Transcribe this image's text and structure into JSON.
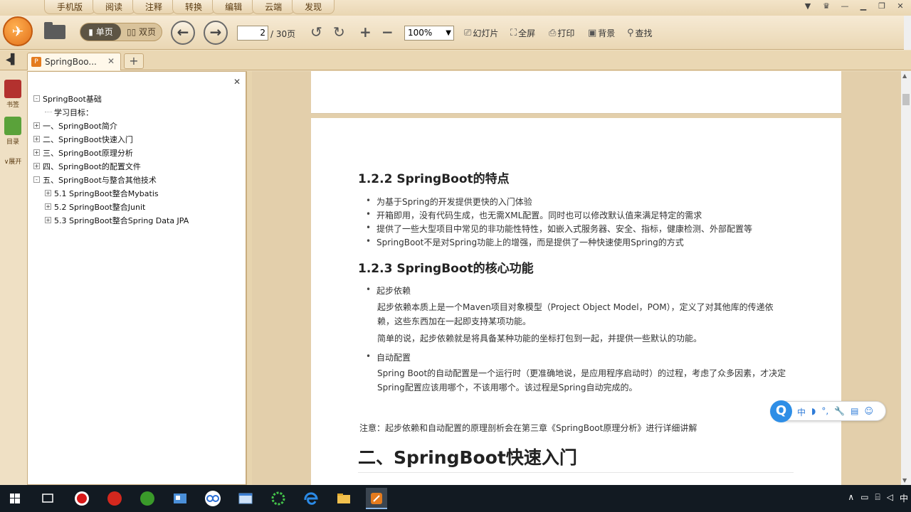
{
  "menu": {
    "tabs": [
      "手机版",
      "阅读",
      "注释",
      "转换",
      "编辑",
      "云端",
      "发现"
    ]
  },
  "toolbar": {
    "single_page": "单页",
    "double_page": "双页",
    "current_page": "2",
    "total_pages": "/ 30页",
    "zoom": "100%",
    "slideshow": "幻灯片",
    "fullscreen": "全屏",
    "print": "打印",
    "background": "背景",
    "find": "查找"
  },
  "tabs": {
    "doc_title": "SpringBoo..."
  },
  "sidebar": {
    "bookmarks": "书签",
    "toc": "目录",
    "expand": "展开"
  },
  "outline": {
    "items": [
      {
        "label": "SpringBoot基础",
        "level": 0,
        "expander": "-"
      },
      {
        "label": "学习目标：",
        "level": 1,
        "expander": ""
      },
      {
        "label": "一、SpringBoot简介",
        "level": 0,
        "expander": "+"
      },
      {
        "label": "二、SpringBoot快速入门",
        "level": 0,
        "expander": "+"
      },
      {
        "label": "三、SpringBoot原理分析",
        "level": 0,
        "expander": "+"
      },
      {
        "label": "四、SpringBoot的配置文件",
        "level": 0,
        "expander": "+"
      },
      {
        "label": "五、SpringBoot与整合其他技术",
        "level": 0,
        "expander": "-"
      },
      {
        "label": "5.1 SpringBoot整合Mybatis",
        "level": 1,
        "expander": "+"
      },
      {
        "label": "5.2 SpringBoot整合Junit",
        "level": 1,
        "expander": "+"
      },
      {
        "label": "5.3 SpringBoot整合Spring Data JPA",
        "level": 1,
        "expander": "+"
      }
    ]
  },
  "document": {
    "h_features": "1.2.2 SpringBoot的特点",
    "features": [
      "为基于Spring的开发提供更快的入门体验",
      "开箱即用，没有代码生成，也无需XML配置。同时也可以修改默认值来满足特定的需求",
      "提供了一些大型项目中常见的非功能性特性，如嵌入式服务器、安全、指标，健康检测、外部配置等",
      "SpringBoot不是对Spring功能上的增强，而是提供了一种快速使用Spring的方式"
    ],
    "h_core": "1.2.3 SpringBoot的核心功能",
    "dep_title": "起步依赖",
    "dep_para1_line1": "起步依赖本质上是一个Maven项目对象模型（Project Object Model，POM），定义了对其他库的传递依",
    "dep_para1_line2": "赖，这些东西加在一起即支持某项功能。",
    "dep_para2": "简单的说，起步依赖就是将具备某种功能的坐标打包到一起，并提供一些默认的功能。",
    "auto_title": "自动配置",
    "auto_para_line1": "Spring Boot的自动配置是一个运行时（更准确地说，是应用程序启动时）的过程，考虑了众多因素，才决定",
    "auto_para_line2": "Spring配置应该用哪个，不该用哪个。该过程是Spring自动完成的。",
    "note": "注意：起步依赖和自动配置的原理剖析会在第三章《SpringBoot原理分析》进行详细讲解",
    "h_quickstart": "二、SpringBoot快速入门"
  },
  "ime": {
    "items": [
      "中",
      "◗",
      "°,",
      "🔧",
      "▤",
      "☺"
    ]
  },
  "taskbar": {
    "tray_lang": "中"
  },
  "colors": {
    "accent": "#e2701a",
    "panel_bg": "#efe0c4",
    "ime_blue": "#2e8ee6"
  }
}
